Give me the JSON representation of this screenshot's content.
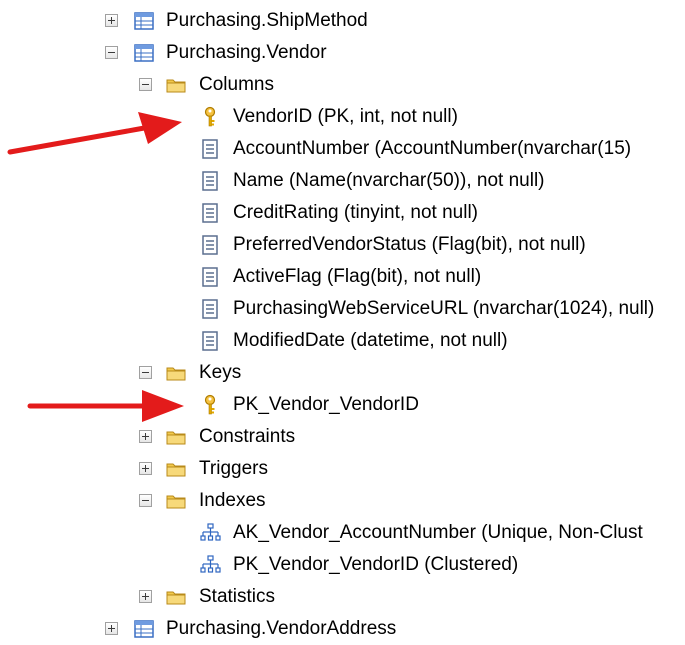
{
  "colors": {
    "text": "#000000",
    "arrow": "#e31b1b",
    "folder": "#f2c94c",
    "key": "#e0a800",
    "table": "#3a6fc4"
  },
  "tree": {
    "ship_method": "Purchasing.ShipMethod",
    "vendor": "Purchasing.Vendor",
    "columns_folder": "Columns",
    "columns": [
      "VendorID (PK, int, not null)",
      "AccountNumber (AccountNumber(nvarchar(15)",
      "Name (Name(nvarchar(50)), not null)",
      "CreditRating (tinyint, not null)",
      "PreferredVendorStatus (Flag(bit), not null)",
      "ActiveFlag (Flag(bit), not null)",
      "PurchasingWebServiceURL (nvarchar(1024), null)",
      "ModifiedDate (datetime, not null)"
    ],
    "keys_folder": "Keys",
    "key_item": "PK_Vendor_VendorID",
    "constraints_folder": "Constraints",
    "triggers_folder": "Triggers",
    "indexes_folder": "Indexes",
    "indexes": [
      "AK_Vendor_AccountNumber (Unique, Non-Clust",
      "PK_Vendor_VendorID (Clustered)"
    ],
    "statistics_folder": "Statistics",
    "vendor_address": "Purchasing.VendorAddress"
  }
}
